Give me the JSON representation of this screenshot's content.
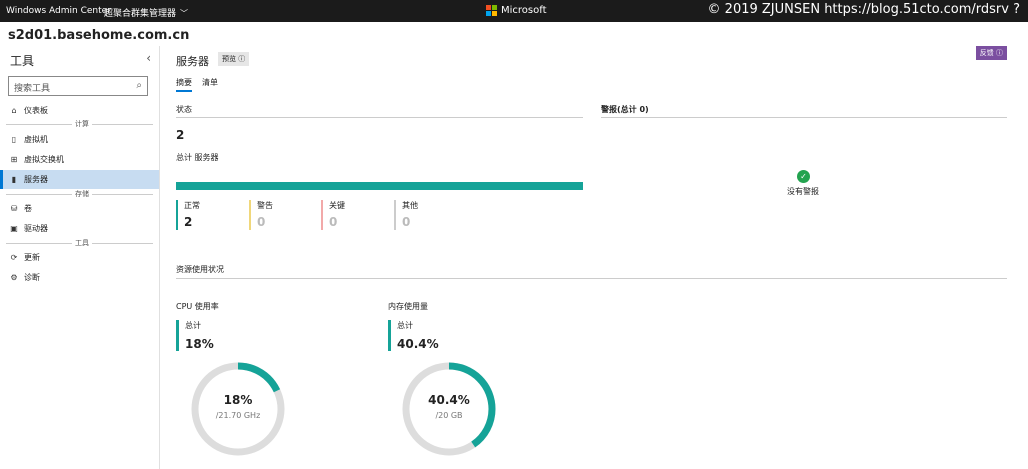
{
  "topbar": {
    "app_name": "Windows Admin Center",
    "context": "超聚合群集管理器",
    "brand": "Microsoft",
    "watermark": "© 2019 ZJUNSEN https://blog.51cto.com/rdsrv ?"
  },
  "host": "s2d01.basehome.com.cn",
  "sidebar": {
    "title": "工具",
    "search_placeholder": "搜索工具",
    "items": {
      "dashboard": "仪表板",
      "vms": "虚拟机",
      "vswitch": "虚拟交换机",
      "servers": "服务器",
      "volumes": "卷",
      "drives": "驱动器",
      "updates": "更新",
      "diagnostics": "诊断"
    },
    "sections": {
      "compute": "计算",
      "storage": "存储",
      "tools": "工具"
    }
  },
  "page": {
    "title": "服务器",
    "preview_badge": "预览 ⓘ",
    "feedback": "反馈 ⓘ",
    "tabs": {
      "summary": "摘要",
      "inventory": "清单"
    }
  },
  "status": {
    "title": "状态",
    "total": "2",
    "total_label": "总计 服务器",
    "normal_label": "正常",
    "normal": "2",
    "warning_label": "警告",
    "warning": "0",
    "critical_label": "关键",
    "critical": "0",
    "other_label": "其他",
    "other": "0"
  },
  "alerts": {
    "title": "警报(总计 0)",
    "none": "没有警报"
  },
  "resources": {
    "title": "资源使用状况",
    "cpu": {
      "title": "CPU 使用率",
      "total_label": "总计",
      "total": "18%",
      "center": "18%",
      "sub": "/21.70 GHz",
      "fraction": 0.18
    },
    "memory": {
      "title": "内存使用量",
      "total_label": "总计",
      "total": "40.4%",
      "center": "40.4%",
      "sub": "/20 GB",
      "fraction": 0.404
    }
  },
  "colors": {
    "accent": "#15a398",
    "track": "#dddddd",
    "brand_blue": "#0078d4",
    "feedback": "#7b4fa0",
    "ok": "#23a34f"
  }
}
